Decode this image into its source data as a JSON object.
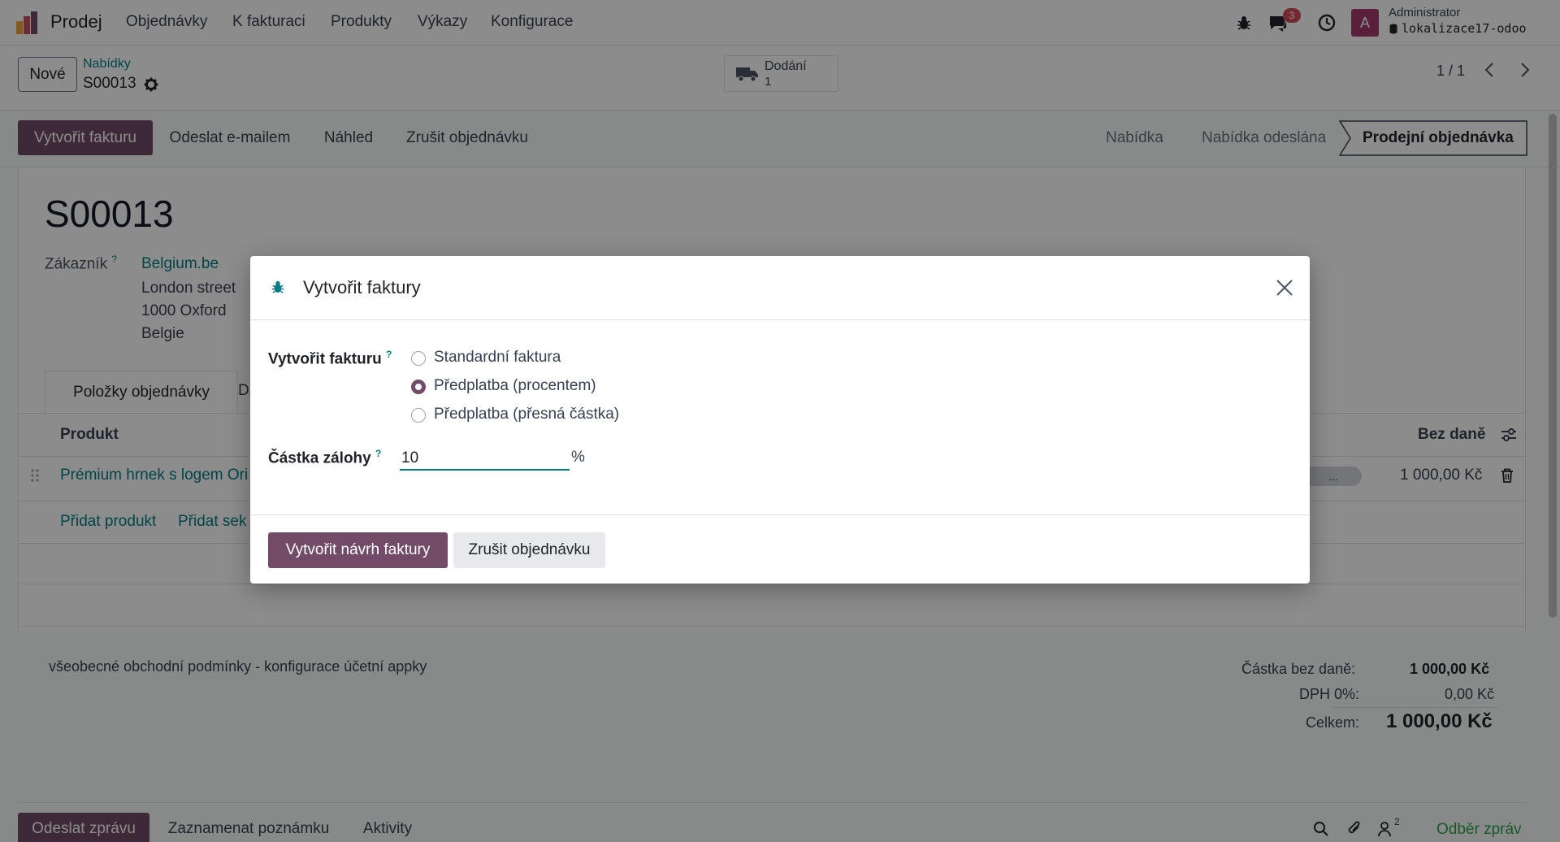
{
  "navbar": {
    "app_name": "Prodej",
    "menu": [
      "Objednávky",
      "K fakturaci",
      "Produkty",
      "Výkazy",
      "Konfigurace"
    ],
    "chat_badge": "3",
    "user_initial": "A",
    "user_name": "Administrator",
    "database": "lokalizace17-odoo"
  },
  "control": {
    "new_label": "Nové",
    "breadcrumb_parent": "Nabídky",
    "record_name": "S00013",
    "delivery_label": "Dodání",
    "delivery_count": "1",
    "pager": "1 / 1"
  },
  "statusbar": {
    "buttons": [
      "Vytvořit fakturu",
      "Odeslat e-mailem",
      "Náhled",
      "Zrušit objednávku"
    ],
    "stages": [
      "Nabídka",
      "Nabídka odeslána",
      "Prodejní objednávka"
    ],
    "active_stage": "Prodejní objednávka"
  },
  "form": {
    "title": "S00013",
    "customer_label": "Zákazník",
    "customer_name": "Belgium.be",
    "address": [
      "London street",
      "1000 Oxford",
      "Belgie"
    ],
    "tabs": [
      "Položky objednávky",
      "Da"
    ],
    "col_product": "Produkt",
    "col_subtotal": "Bez daně",
    "line_product": "Prémium hrnek s logem Ori",
    "line_tag": "...",
    "line_subtotal": "1 000,00 Kč",
    "add_product": "Přidat produkt",
    "add_section": "Přidat sek",
    "terms": "všeobecné obchodní podmínky - konfigurace účetní appky",
    "totals": {
      "untaxed_label": "Částka bez daně:",
      "untaxed_value": "1 000,00 Kč",
      "tax_label": "DPH 0%:",
      "tax_value": "0,00 Kč",
      "total_label": "Celkem:",
      "total_value": "1 000,00 Kč"
    }
  },
  "chatter": {
    "send_message": "Odeslat zprávu",
    "log_note": "Zaznamenat poznámku",
    "activities": "Aktivity",
    "followers_count": "2",
    "follow_label": "Odběr zpráv"
  },
  "modal": {
    "title": "Vytvořit faktury",
    "field_label": "Vytvořit fakturu",
    "options": [
      "Standardní faktura",
      "Předplatba (procentem)",
      "Předplatba (přesná částka)"
    ],
    "selected_index": 1,
    "amount_label": "Částka zálohy",
    "amount_value": "10",
    "amount_unit": "%",
    "primary_button": "Vytvořit návrh faktury",
    "secondary_button": "Zrušit objednávku"
  },
  "colors": {
    "brand": "#714b67",
    "link": "#017e84",
    "badge": "#d44c59"
  }
}
